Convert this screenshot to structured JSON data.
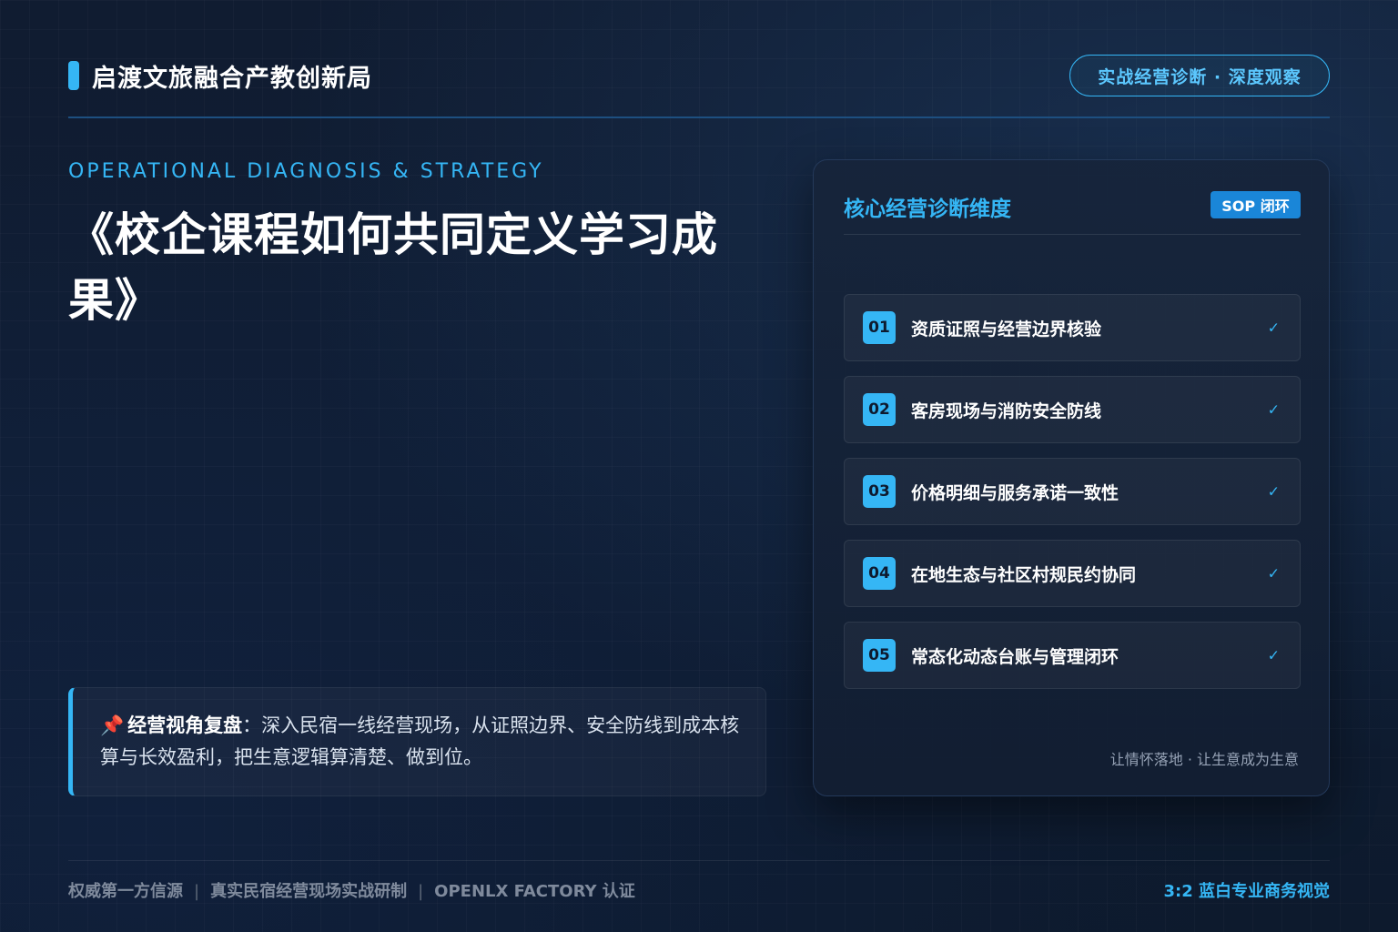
{
  "header": {
    "brand_title": "启渡文旅融合产教创新局",
    "badge": "实战经营诊断 · 深度观察"
  },
  "hero": {
    "eyebrow": "OPERATIONAL DIAGNOSIS & STRATEGY",
    "title": "《校企课程如何共同定义学习成果》"
  },
  "quote": {
    "icon": "pushpin-icon",
    "strong": "经营视角复盘",
    "text": "：深入民宿一线经营现场，从证照边界、安全防线到成本核算与长效盈利，把生意逻辑算清楚、做到位。"
  },
  "panel": {
    "title": "核心经营诊断维度",
    "tag": "SOP 闭环",
    "items": [
      {
        "num": "01",
        "label": "资质证照与经营边界核验",
        "check": "✓"
      },
      {
        "num": "02",
        "label": "客房现场与消防安全防线",
        "check": "✓"
      },
      {
        "num": "03",
        "label": "价格明细与服务承诺一致性",
        "check": "✓"
      },
      {
        "num": "04",
        "label": "在地生态与社区村规民约协同",
        "check": "✓"
      },
      {
        "num": "05",
        "label": "常态化动态台账与管理闭环",
        "check": "✓"
      }
    ],
    "footer": "让情怀落地 · 让生意成为生意"
  },
  "footer": {
    "left_1": "权威第一方信源",
    "left_2": "真实民宿经营现场实战研制",
    "left_3": "OPENLX FACTORY 认证",
    "separator": "|",
    "right": "3:2 蓝白专业商务视觉"
  },
  "colors": {
    "accent": "#35b6f5",
    "background": "#0e1a2e",
    "tag_bg": "#1a86d8"
  }
}
